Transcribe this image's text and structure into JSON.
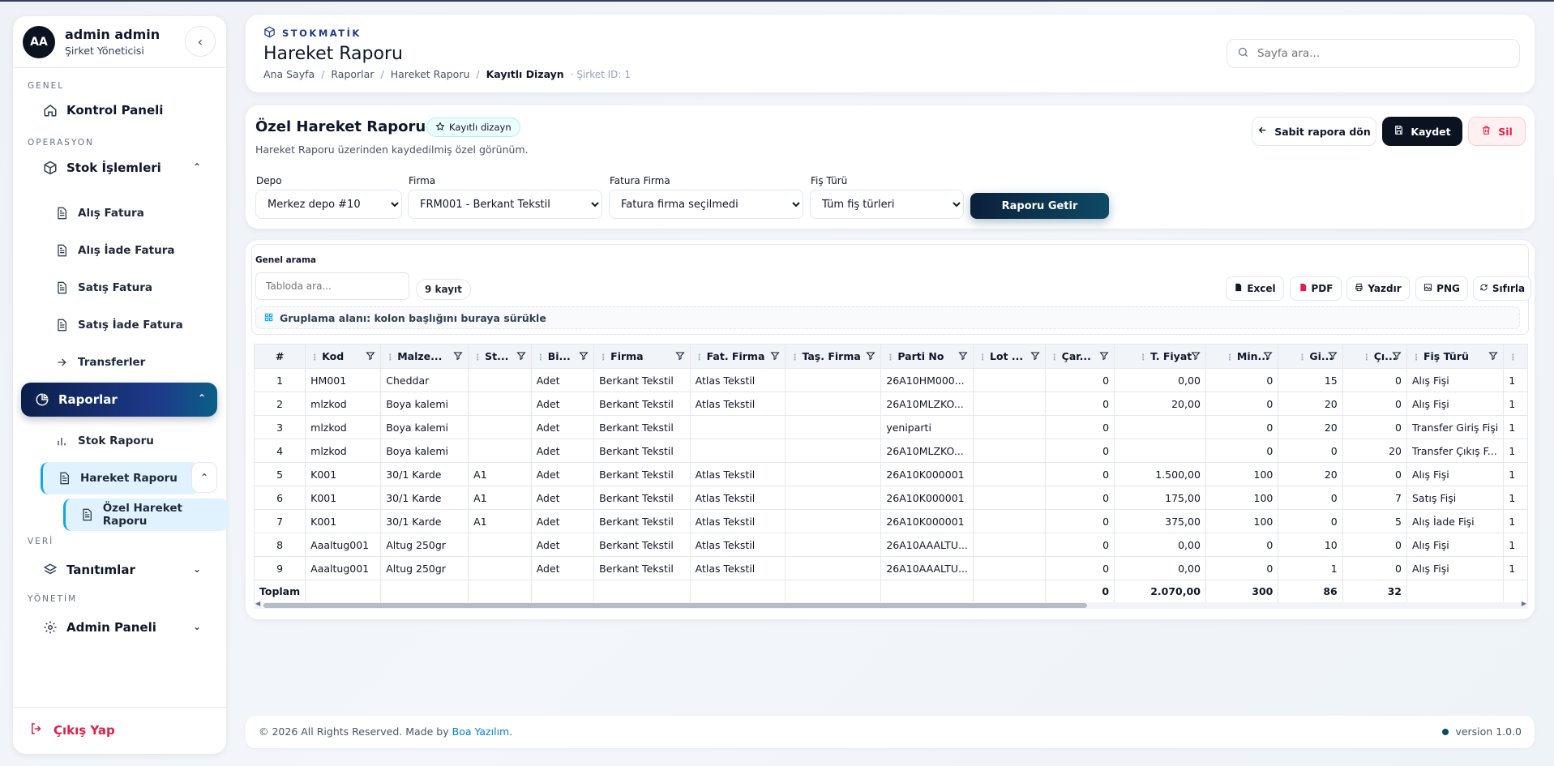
{
  "user": {
    "initials": "AA",
    "name": "admin admin",
    "role": "Şirket Yöneticisi"
  },
  "sidebar": {
    "sections": {
      "genel": "GENEL",
      "operasyon": "OPERASYON",
      "veri": "VERİ",
      "yonetim": "YÖNETİM"
    },
    "items": {
      "kontrol": "Kontrol Paneli",
      "stok_islemleri": "Stok İşlemleri",
      "alis_fatura": "Alış Fatura",
      "alis_iade": "Alış İade Fatura",
      "satis_fatura": "Satış Fatura",
      "satis_iade": "Satış İade Fatura",
      "transferler": "Transferler",
      "raporlar": "Raporlar",
      "stok_raporu": "Stok Raporu",
      "hareket_raporu": "Hareket Raporu",
      "ozel_hareket": "Özel Hareket Raporu",
      "tanimlar": "Tanıtımlar",
      "admin_paneli": "Admin Paneli"
    },
    "logout": "Çıkış Yap"
  },
  "header": {
    "brand": "STOKMATİK",
    "title": "Hareket Raporu",
    "breadcrumb": [
      "Ana Sayfa",
      "Raporlar",
      "Hareket Raporu",
      "Kayıtlı Dizayn"
    ],
    "meta": "· Şirket ID: 1",
    "search_placeholder": "Sayfa ara..."
  },
  "report": {
    "title": "Özel Hareket Raporu",
    "badge": "Kayıtlı dizayn",
    "subtitle": "Hareket Raporu üzerinden kaydedilmiş özel görünüm.",
    "back_btn": "Sabit rapora dön",
    "save_btn": "Kaydet",
    "delete_btn": "Sil",
    "filters": {
      "depo": {
        "label": "Depo",
        "value": "Merkez depo #10"
      },
      "firma": {
        "label": "Firma",
        "value": "FRM001 - Berkant Tekstil"
      },
      "fatura_firma": {
        "label": "Fatura Firma",
        "value": "Fatura firma seçilmedi"
      },
      "fis_turu": {
        "label": "Fiş Türü",
        "value": "Tüm fiş türleri"
      }
    },
    "run_btn": "Raporu Getir"
  },
  "table": {
    "search_label": "Genel arama",
    "search_placeholder": "Tabloda ara...",
    "count": "9 kayıt",
    "export": {
      "excel": "Excel",
      "pdf": "PDF",
      "print": "Yazdır",
      "png": "PNG",
      "reset": "Sıfırla"
    },
    "group_hint": "Gruplama alanı: kolon başlığını buraya sürükle",
    "columns": [
      "#",
      "Kod",
      "Malze...",
      "St...",
      "Bi...",
      "Firma",
      "Fat. Firma",
      "Taş. Firma",
      "Parti No",
      "Lot ...",
      "Çar...",
      "T. Fiyat",
      "Min...",
      "Gi...",
      "Çı...",
      "Fiş Türü"
    ],
    "rows": [
      [
        "1",
        "HM001",
        "Cheddar",
        "",
        "Adet",
        "Berkant Tekstil",
        "Atlas Tekstil",
        "",
        "26A10HM000...",
        "",
        "0",
        "0,00",
        "0",
        "15",
        "0",
        "Alış Fişi",
        "1"
      ],
      [
        "2",
        "mlzkod",
        "Boya kalemi",
        "",
        "Adet",
        "Berkant Tekstil",
        "Atlas Tekstil",
        "",
        "26A10MLZKO...",
        "",
        "0",
        "20,00",
        "0",
        "20",
        "0",
        "Alış Fişi",
        "1"
      ],
      [
        "3",
        "mlzkod",
        "Boya kalemi",
        "",
        "Adet",
        "Berkant Tekstil",
        "",
        "",
        "yeniparti",
        "",
        "0",
        "",
        "0",
        "20",
        "0",
        "Transfer Giriş Fişi",
        "1"
      ],
      [
        "4",
        "mlzkod",
        "Boya kalemi",
        "",
        "Adet",
        "Berkant Tekstil",
        "",
        "",
        "26A10MLZKO...",
        "",
        "0",
        "",
        "0",
        "0",
        "20",
        "Transfer Çıkış F...",
        "1"
      ],
      [
        "5",
        "K001",
        "30/1 Karde",
        "A1",
        "Adet",
        "Berkant Tekstil",
        "Atlas Tekstil",
        "",
        "26A10K000001",
        "",
        "0",
        "1.500,00",
        "100",
        "20",
        "0",
        "Alış Fişi",
        "1"
      ],
      [
        "6",
        "K001",
        "30/1 Karde",
        "A1",
        "Adet",
        "Berkant Tekstil",
        "Atlas Tekstil",
        "",
        "26A10K000001",
        "",
        "0",
        "175,00",
        "100",
        "0",
        "7",
        "Satış Fişi",
        "1"
      ],
      [
        "7",
        "K001",
        "30/1 Karde",
        "A1",
        "Adet",
        "Berkant Tekstil",
        "Atlas Tekstil",
        "",
        "26A10K000001",
        "",
        "0",
        "375,00",
        "100",
        "0",
        "5",
        "Alış İade Fişi",
        "1"
      ],
      [
        "8",
        "Aaaltug001",
        "Altug 250gr",
        "",
        "Adet",
        "Berkant Tekstil",
        "Atlas Tekstil",
        "",
        "26A10AAALTU...",
        "",
        "0",
        "0,00",
        "0",
        "10",
        "0",
        "Alış Fişi",
        "1"
      ],
      [
        "9",
        "Aaaltug001",
        "Altug 250gr",
        "",
        "Adet",
        "Berkant Tekstil",
        "Atlas Tekstil",
        "",
        "26A10AAALTU...",
        "",
        "0",
        "0,00",
        "0",
        "1",
        "0",
        "Alış Fişi",
        "1"
      ]
    ],
    "totals": {
      "label": "Toplam",
      "car": "0",
      "fiyat": "2.070,00",
      "min": "300",
      "giris": "86",
      "cikis": "32"
    }
  },
  "footer": {
    "copy": "© 2026 All Rights Reserved. Made by",
    "company": "Boa Yazılım",
    "dot": ".",
    "version": "version 1.0.0"
  },
  "colors": {
    "accent": "#0e4a66",
    "danger": "#e11d48",
    "nav_active": "#1e3a8a"
  }
}
